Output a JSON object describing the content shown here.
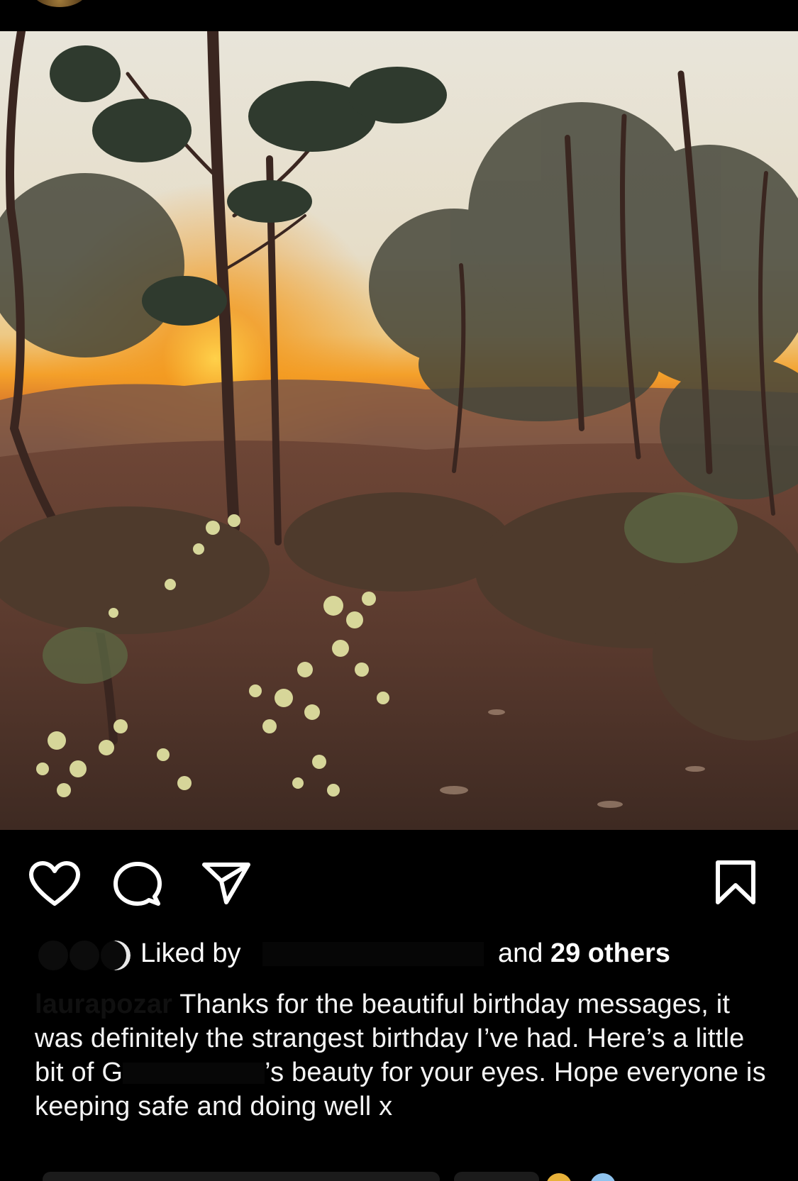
{
  "post": {
    "image": {
      "alt_icon": "sunset-bushland-photo",
      "palette": {
        "sky": "#e9e3d4",
        "sun": "#f6a31f",
        "horizon": "#d9782a",
        "ground": "#5a3b2c",
        "foliage": "#3a4a3a",
        "blossom": "#e9ecb0"
      }
    },
    "actions": {
      "like_icon": "heart-icon",
      "comment_icon": "comment-icon",
      "share_icon": "paper-plane-icon",
      "save_icon": "bookmark-icon"
    },
    "likes": {
      "prefix": "Liked by",
      "connector": "and",
      "others": "29 others"
    },
    "caption": {
      "username": "laurapozar",
      "text_part1": "Thanks for the beautiful birthday messages, it was definitely the strangest birthday I’ve had. Here’s a little bit of G",
      "text_part2": "’s beauty for your eyes. Hope everyone is keeping safe and doing well x"
    }
  },
  "colors": {
    "background": "#000000",
    "text": "#ffffff"
  }
}
